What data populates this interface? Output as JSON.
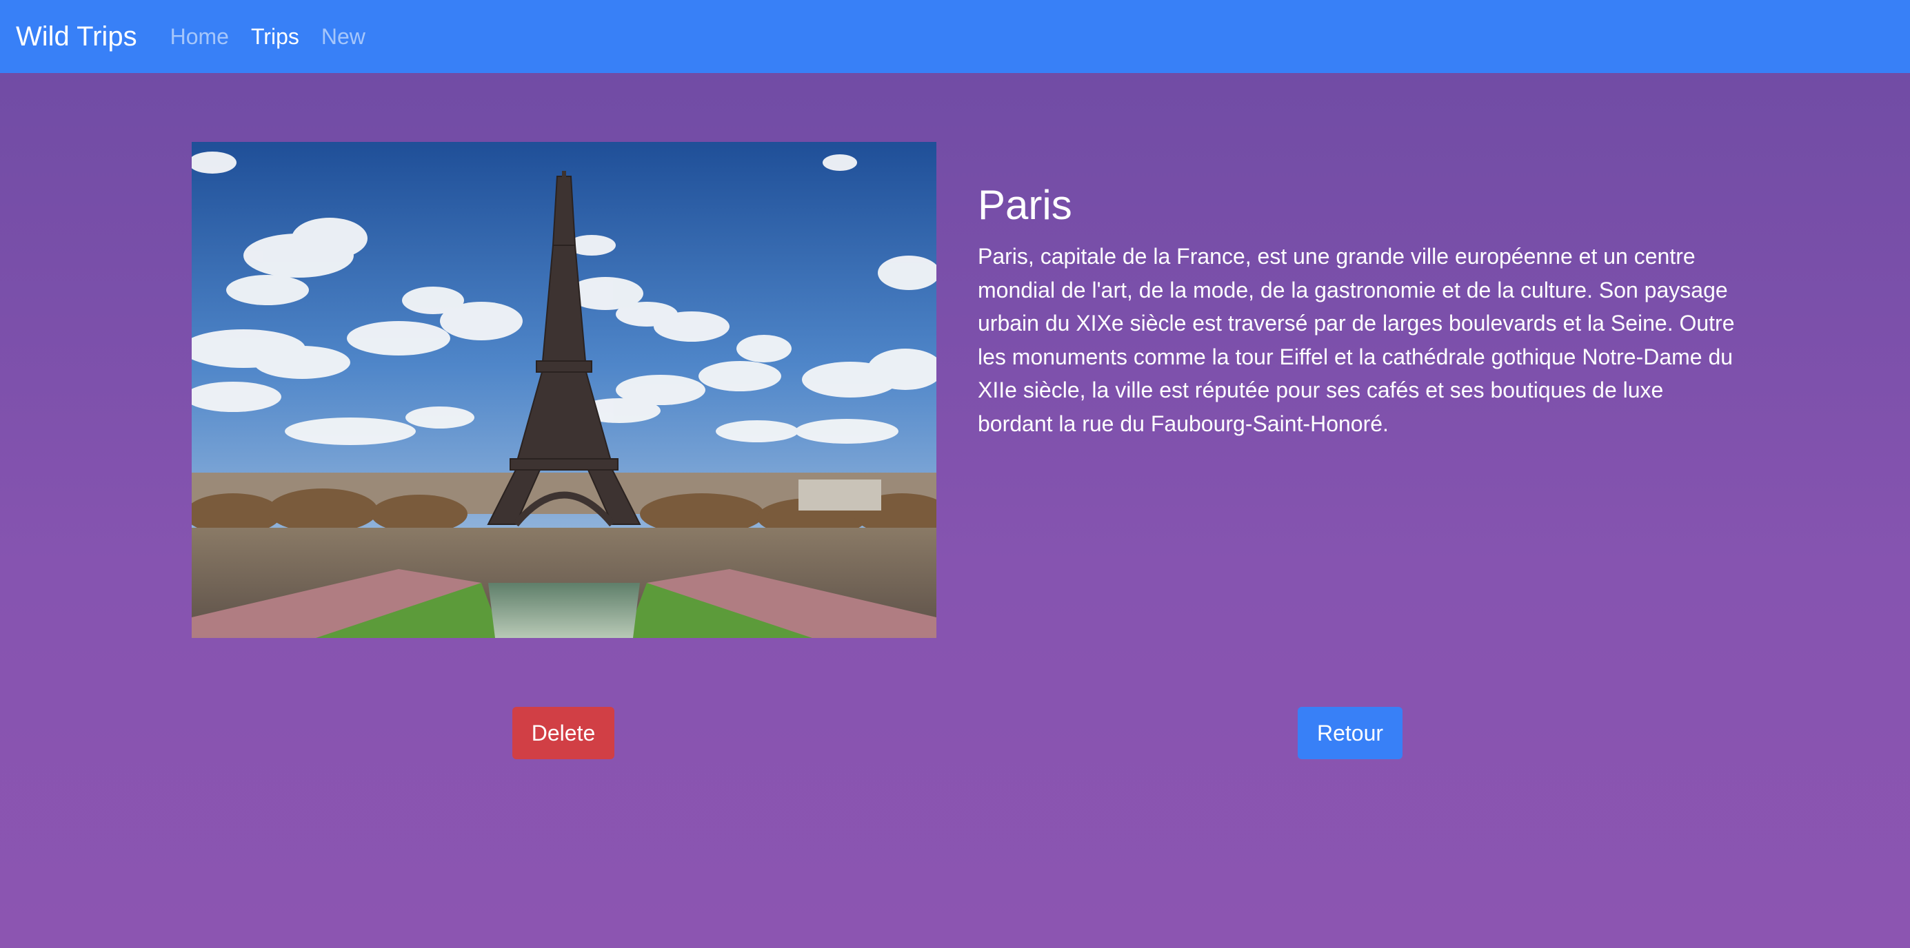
{
  "navbar": {
    "brand": "Wild Trips",
    "links": [
      {
        "label": "Home",
        "active": false
      },
      {
        "label": "Trips",
        "active": true
      },
      {
        "label": "New",
        "active": false
      }
    ]
  },
  "trip": {
    "title": "Paris",
    "description": "Paris, capitale de la France, est une grande ville européenne et un centre mondial de l'art, de la mode, de la gastronomie et de la culture. Son paysage urbain du XIXe siècle est traversé par de larges boulevards et la Seine. Outre les monuments comme la tour Eiffel et la cathédrale gothique Notre-Dame du XIIe siècle, la ville est réputée pour ses cafés et ses boutiques de luxe bordant la rue du Faubourg-Saint-Honoré.",
    "image_icon": "eiffel-tower-photo"
  },
  "actions": {
    "delete_label": "Delete",
    "back_label": "Retour"
  },
  "colors": {
    "navbar": "#3880f7",
    "background_top": "#6e4ba3",
    "background_bottom": "#8c55b1",
    "delete": "#d13f45",
    "back": "#3880f7",
    "text": "#ffffff"
  }
}
